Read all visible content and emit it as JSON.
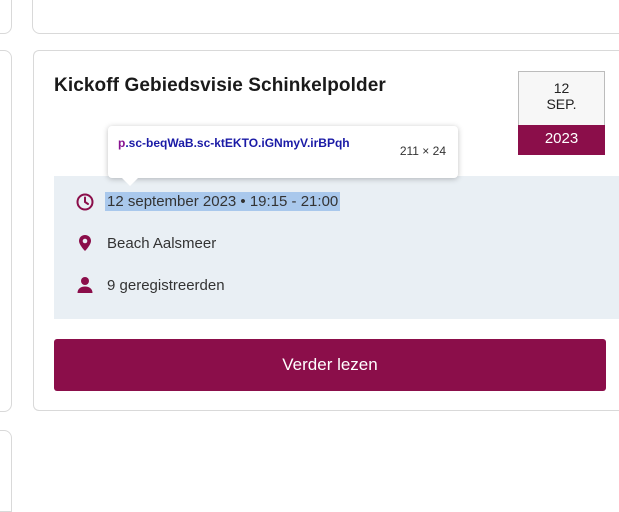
{
  "event": {
    "title": "Kickoff Gebiedsvisie Schinkelpolder",
    "date": {
      "day": "12",
      "month": "SEP.",
      "year": "2023"
    },
    "datetime": "12 september 2023 • 19:15 - 21:00",
    "location": "Beach Aalsmeer",
    "registrations": "9 geregistreerden",
    "read_more_label": "Verder lezen"
  },
  "devtools_tooltip": {
    "tag": "p",
    "classes": ".sc-beqWaB.sc-ktEKTO.iGNmyV.irBPqh",
    "dimensions": "211 × 24"
  },
  "colors": {
    "brand": "#8b0e4a",
    "info_panel_bg": "#e9eff4",
    "selection_highlight": "#a9c8ec"
  },
  "icons": {
    "time": "clock-icon",
    "location": "map-pin-icon",
    "people": "person-icon"
  }
}
